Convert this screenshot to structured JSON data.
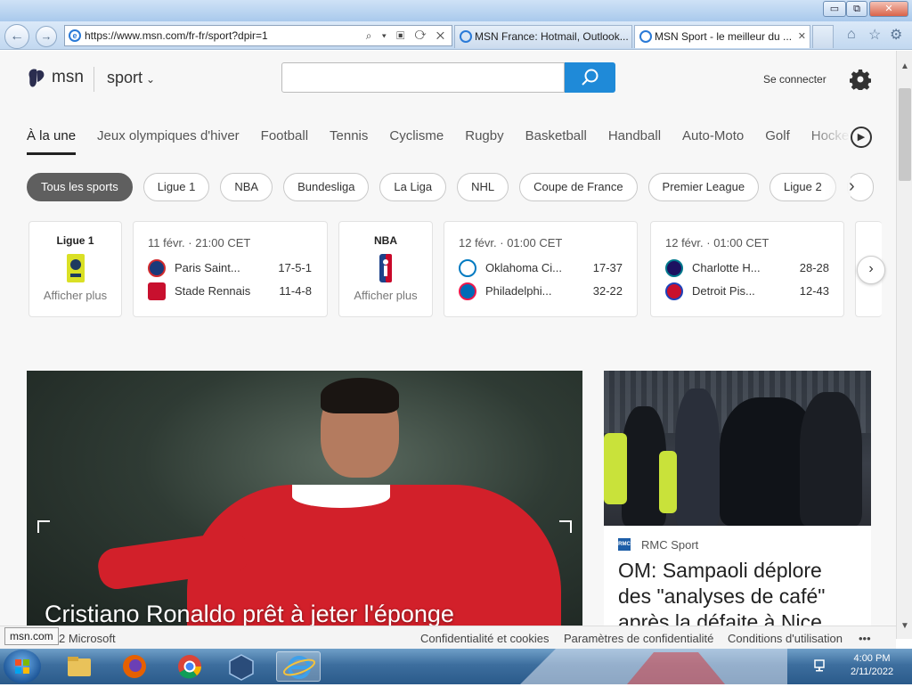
{
  "browser": {
    "address_url": "https://www.msn.com/fr-fr/sport?dpir=1",
    "tabs": [
      {
        "label": "MSN France: Hotmail, Outlook..."
      },
      {
        "label": "MSN Sport - le meilleur du ...",
        "close": "✕"
      }
    ],
    "window_buttons": {
      "minimize": "▭",
      "maximize": "⧉",
      "close": "✕"
    }
  },
  "header": {
    "brand": "msn",
    "section": "sport",
    "search_placeholder": "",
    "signin": "Se connecter"
  },
  "nav": {
    "tabs": [
      "À la une",
      "Jeux olympiques d'hiver",
      "Football",
      "Tennis",
      "Cyclisme",
      "Rugby",
      "Basketball",
      "Handball",
      "Auto-Moto",
      "Golf",
      "Hocke"
    ],
    "active_index": 0
  },
  "chips": [
    "Tous les sports",
    "Ligue 1",
    "NBA",
    "Bundesliga",
    "La Liga",
    "NHL",
    "Coupe de France",
    "Premier League",
    "Ligue 2"
  ],
  "scores": {
    "ligue1": {
      "league": "Ligue 1",
      "more": "Afficher plus"
    },
    "match1": {
      "time": "11 févr. · 21:00 CET",
      "home": {
        "name": "Paris Saint...",
        "record": "17-5-1"
      },
      "away": {
        "name": "Stade Rennais",
        "record": "11-4-8"
      }
    },
    "nba": {
      "league": "NBA",
      "more": "Afficher plus"
    },
    "match2": {
      "time": "12 févr. · 01:00 CET",
      "home": {
        "name": "Oklahoma Ci...",
        "record": "17-37"
      },
      "away": {
        "name": "Philadelphi...",
        "record": "32-22"
      }
    },
    "match3": {
      "time": "12 févr. · 01:00 CET",
      "home": {
        "name": "Charlotte H...",
        "record": "28-28"
      },
      "away": {
        "name": "Detroit Pis...",
        "record": "12-43"
      }
    }
  },
  "hero": {
    "headline": "Cristiano Ronaldo prêt à jeter l'éponge"
  },
  "side_story": {
    "source": "RMC Sport",
    "source_icon_text": "RMC",
    "headline": "OM: Sampaoli déplore des \"analyses de café\" après la défaite à Nice"
  },
  "footer": {
    "status_url": "msn.com",
    "copyright": "2 Microsoft",
    "links": [
      "Confidentialité et cookies",
      "Paramètres de confidentialité",
      "Conditions d'utilisation",
      "•••"
    ]
  },
  "taskbar": {
    "time": "4:00 PM",
    "date": "2/11/2022"
  }
}
